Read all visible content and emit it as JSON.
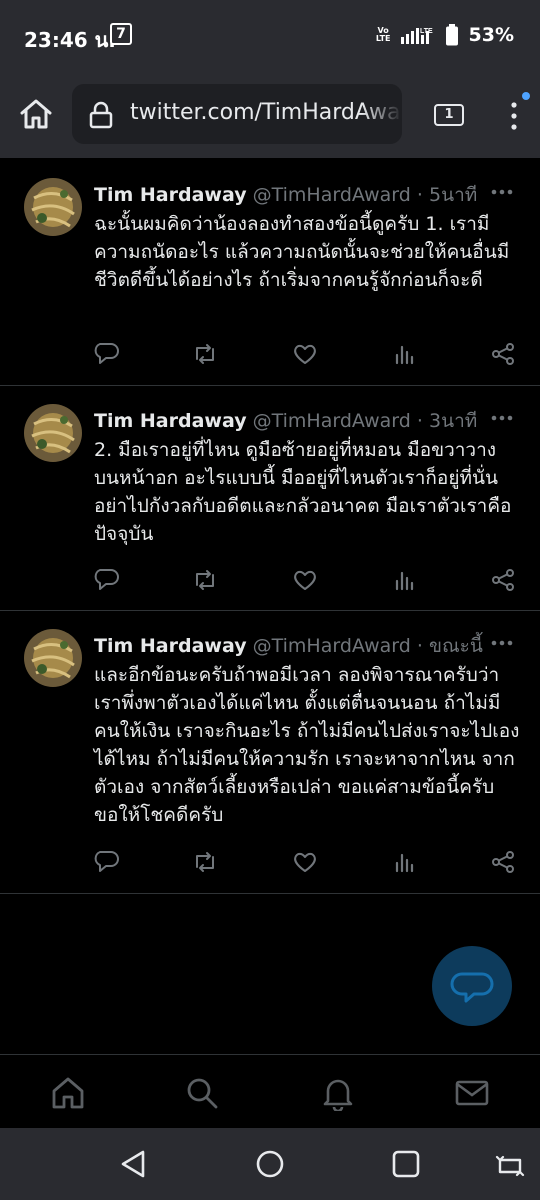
{
  "status_bar": {
    "time": "23:46 น.",
    "store_badge": "7",
    "volte_top": "Vo",
    "volte_bottom": "LTE",
    "network": "LTE",
    "battery": "53%"
  },
  "browser": {
    "url": "twitter.com/TimHardAward",
    "tab_count": "1"
  },
  "tweets": [
    {
      "name": "Tim Hardaway",
      "handle": "@TimHardAward",
      "sep": "·",
      "time": "5นาที",
      "text": "ฉะนั้นผมคิดว่าน้องลองทำสองข้อนี้ดูครับ 1. เรามีความถนัดอะไร แล้วความถนัดนั้นจะช่วยให้คนอื่นมีชีวิตดีขึ้นได้อย่างไร ถ้าเริ่มจากคนรู้จักก่อนก็จะดี"
    },
    {
      "name": "Tim Hardaway",
      "handle": "@TimHardAward",
      "sep": "·",
      "time": "3นาที",
      "text": "2. มือเราอยู่ที่ไหน ดูมือซ้ายอยู่ที่หมอน มือขวาวางบนหน้าอก อะไรแบบนี้ มืออยู่ที่ไหนตัวเราก็อยู่ที่นั่น อย่าไปกังวลกับอดีตและกลัวอนาคต มือเราตัวเราคือปัจจุบัน"
    },
    {
      "name": "Tim Hardaway",
      "handle": "@TimHardAward",
      "sep": "·",
      "time": "ขณะนี้",
      "text": "และอีกข้อนะครับถ้าพอมีเวลา ลองพิจารณาครับว่าเราพึ่งพาตัวเองได้แค่ไหน ตั้งแต่ตื่นจนนอน ถ้าไม่มีคนให้เงิน เราจะกินอะไร ถ้าไม่มีคนไปส่งเราจะไปเองได้ไหม ถ้าไม่มีคนให้ความรัก เราจะหาจากไหน จากตัวเอง จากสัตว์เลี้ยงหรือเปล่า ขอแค่สามข้อนี้ครับ ขอให้โชคดีครับ"
    }
  ],
  "colors": {
    "background": "#000000",
    "chrome": "#2a2b30",
    "text_primary": "#e7e9ea",
    "text_secondary": "#71767b",
    "fab": "#0d3b5c"
  },
  "icons": {
    "actions": [
      "reply-icon",
      "retweet-icon",
      "like-icon",
      "views-icon",
      "share-icon"
    ],
    "bottom_nav": [
      "home-icon",
      "search-icon",
      "notifications-icon",
      "messages-icon"
    ],
    "system_nav": [
      "back-icon",
      "home-circle-icon",
      "recents-icon",
      "rotate-icon"
    ]
  }
}
